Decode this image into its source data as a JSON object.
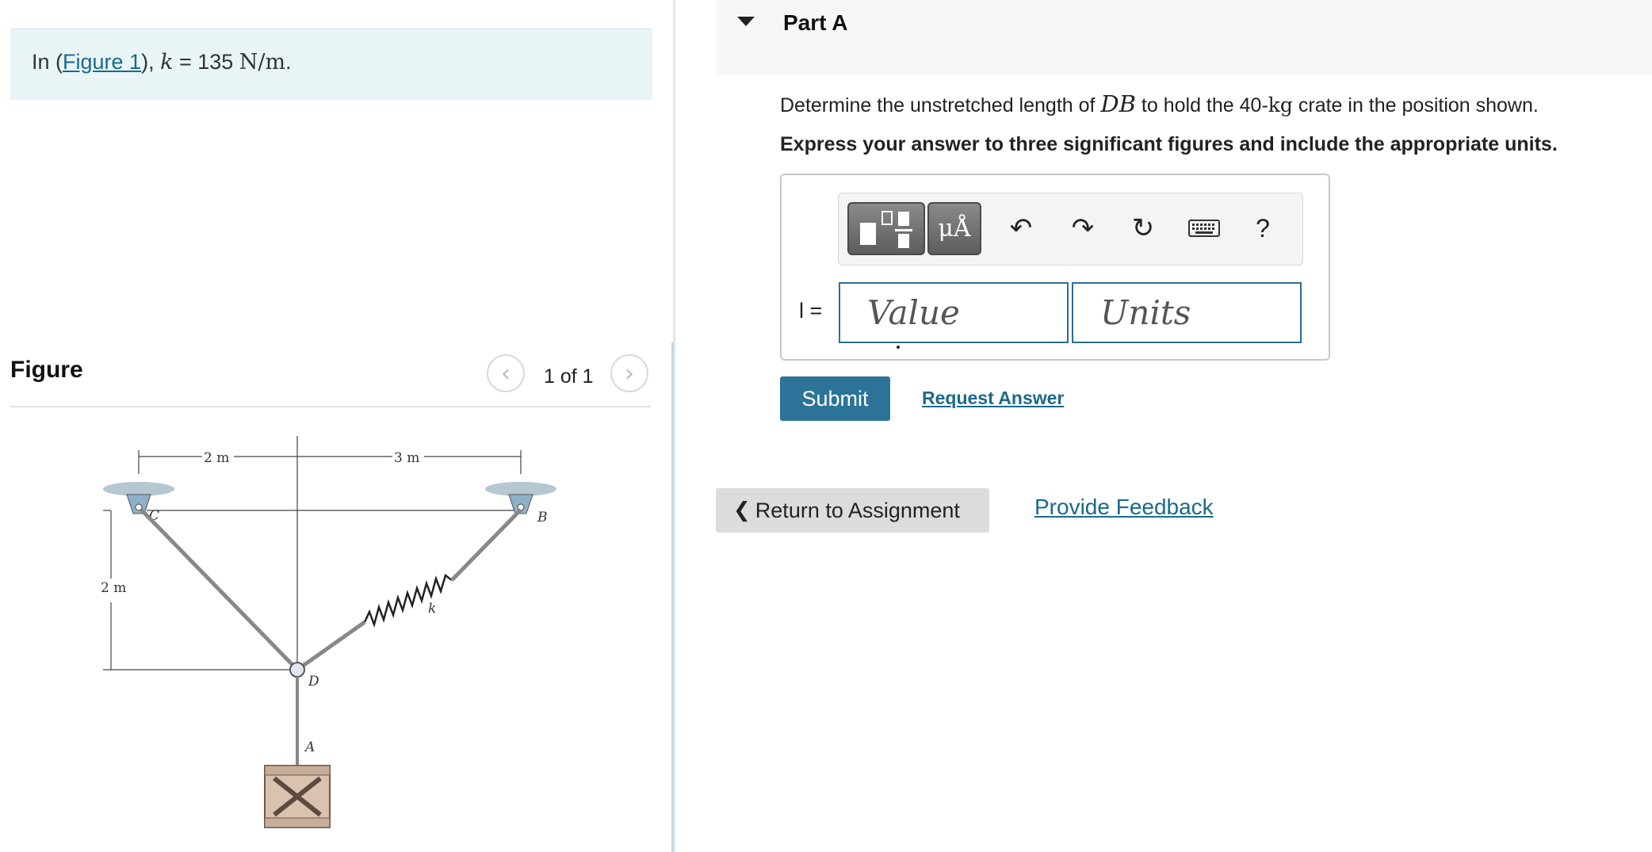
{
  "problem": {
    "prefix": "In (",
    "figure_link": "Figure 1",
    "suffix_open": "), ",
    "k_symbol": "k",
    "equals": " = 135 ",
    "units": "N/m",
    "period": "."
  },
  "figure_panel": {
    "heading": "Figure",
    "page_count": "1 of 1",
    "prev_icon": "‹",
    "next_icon": "›",
    "diagram_labels": {
      "dim_top_left": "2 m",
      "dim_top_right": "3 m",
      "dim_left": "2 m",
      "point_c": "C",
      "point_b": "B",
      "point_d": "D",
      "point_a": "A",
      "spring_k": "k"
    }
  },
  "part": {
    "title": "Part A",
    "question_prefix": "Determine the unstretched length of ",
    "question_var": "DB",
    "question_mid": " to hold the 40-",
    "question_unit": "kg",
    "question_suffix": " crate in the position shown.",
    "instruction": "Express your answer to three significant figures and include the appropriate units."
  },
  "answer": {
    "variable": "l =",
    "value_placeholder": "Value",
    "units_placeholder": "Units",
    "toolbar": {
      "units_label": "μÅ",
      "undo_icon": "↶",
      "redo_icon": "↷",
      "reset_icon": "↻",
      "help_label": "?"
    }
  },
  "actions": {
    "submit": "Submit",
    "request_answer": "Request Answer",
    "return_to_assignment": "Return to Assignment",
    "provide_feedback": "Provide Feedback"
  }
}
